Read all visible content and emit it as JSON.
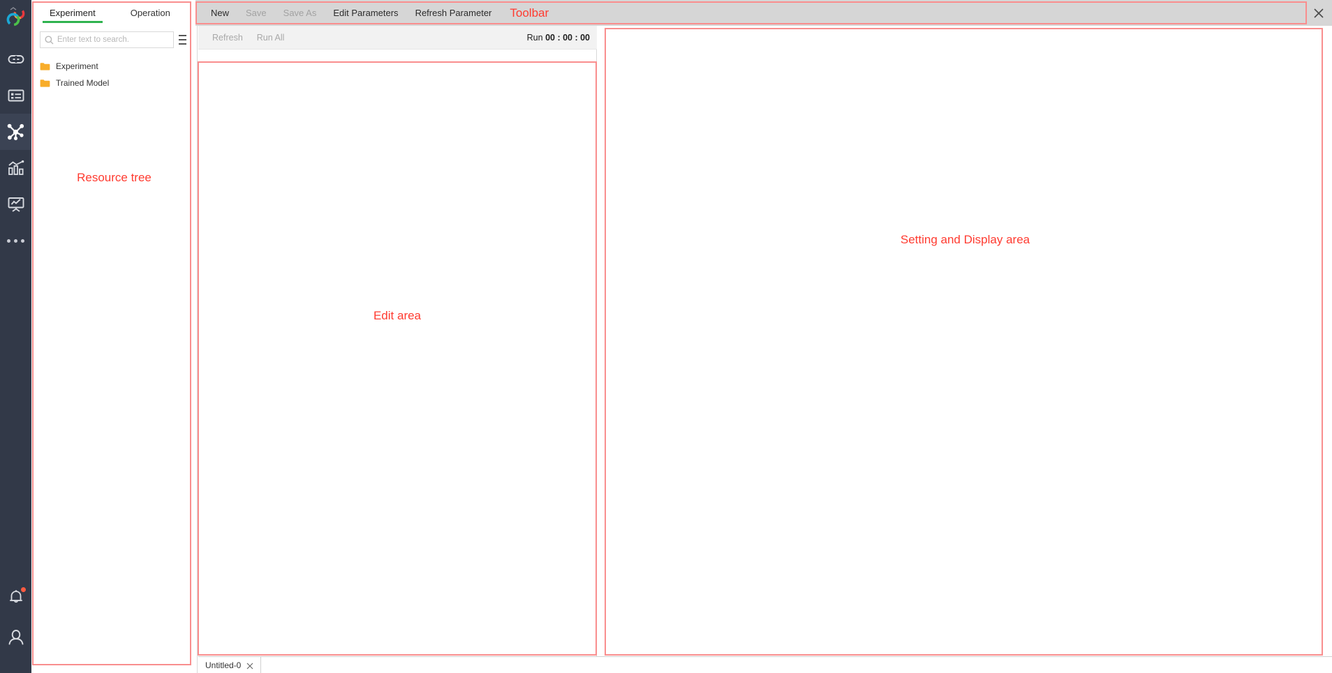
{
  "rail": {
    "logo_name": "app-logo",
    "items": [
      {
        "id": "link",
        "icon": "link-icon",
        "active": false
      },
      {
        "id": "dataset",
        "icon": "list-card-icon",
        "active": false
      },
      {
        "id": "pipeline",
        "icon": "node-graph-icon",
        "active": true
      },
      {
        "id": "analytics",
        "icon": "bar-chart-icon",
        "active": false
      },
      {
        "id": "monitor",
        "icon": "presentation-icon",
        "active": false
      },
      {
        "id": "more",
        "icon": "ellipsis-icon",
        "active": false
      }
    ],
    "bottom_items": [
      {
        "id": "notifications",
        "icon": "bell-icon",
        "has_badge": true
      },
      {
        "id": "account",
        "icon": "user-icon",
        "has_badge": false
      }
    ]
  },
  "resource": {
    "tabs": [
      {
        "label": "Experiment",
        "active": true
      },
      {
        "label": "Operation",
        "active": false
      }
    ],
    "search": {
      "placeholder": "Enter text to search.",
      "value": ""
    },
    "tree": [
      {
        "label": "Experiment",
        "icon": "folder-icon"
      },
      {
        "label": "Trained Model",
        "icon": "folder-icon"
      }
    ],
    "annotation": "Resource tree"
  },
  "toolbar": {
    "items": [
      {
        "label": "New",
        "disabled": false
      },
      {
        "label": "Save",
        "disabled": true
      },
      {
        "label": "Save As",
        "disabled": true
      },
      {
        "label": "Edit Parameters",
        "disabled": false
      },
      {
        "label": "Refresh Parameter",
        "disabled": false
      }
    ],
    "annotation": "Toolbar",
    "close_icon": "close-icon"
  },
  "subtoolbar": {
    "items": [
      {
        "label": "Refresh",
        "disabled": true
      },
      {
        "label": "Run All",
        "disabled": true
      }
    ],
    "run_label": "Run",
    "run_time": "00 : 00 : 00"
  },
  "edit_area": {
    "annotation": "Edit area"
  },
  "setting_area": {
    "annotation": "Setting and Display area"
  },
  "bottom_tabs": [
    {
      "label": "Untitled-0",
      "close_icon": "close-icon",
      "active": true
    }
  ],
  "colors": {
    "rail_bg": "#323948",
    "rail_active": "#3b4354",
    "toolbar_bg": "#d6d6d6",
    "annotation_red": "#ff3b30",
    "annotation_box": "#f98e8e",
    "tab_active_underline": "#2fb34f",
    "folder_orange": "#f8ad2a",
    "badge_red": "#ff5b41"
  }
}
